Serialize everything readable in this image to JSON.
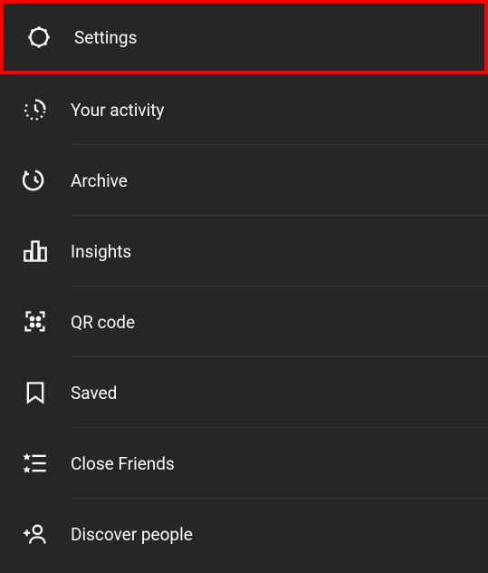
{
  "menu": {
    "items": [
      {
        "label": "Settings",
        "icon": "gear",
        "highlighted": true
      },
      {
        "label": "Your activity",
        "icon": "activity",
        "highlighted": false
      },
      {
        "label": "Archive",
        "icon": "archive",
        "highlighted": false
      },
      {
        "label": "Insights",
        "icon": "insights",
        "highlighted": false
      },
      {
        "label": "QR code",
        "icon": "qrcode",
        "highlighted": false
      },
      {
        "label": "Saved",
        "icon": "saved",
        "highlighted": false
      },
      {
        "label": "Close Friends",
        "icon": "close-friends",
        "highlighted": false
      },
      {
        "label": "Discover people",
        "icon": "discover-people",
        "highlighted": false
      }
    ]
  }
}
